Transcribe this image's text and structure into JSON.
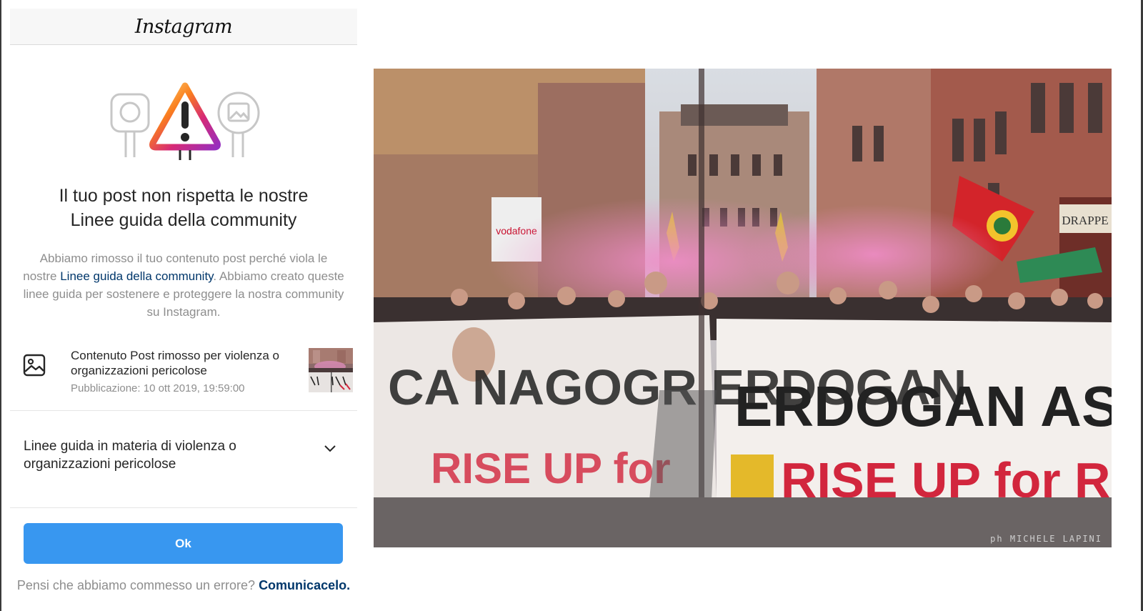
{
  "app": {
    "brand": "Instagram"
  },
  "notice": {
    "headline_line1": "Il tuo post non rispetta le nostre",
    "headline_line2": "Linee guida della community",
    "desc_part1": "Abbiamo rimosso il tuo contenuto post perché viola le nostre ",
    "desc_link": "Linee guida della community",
    "desc_part2": ". Abbiamo creato queste linee guida per sostenere e proteggere la nostra community su Instagram."
  },
  "removed_item": {
    "icon": "image-icon",
    "title": "Contenuto Post rimosso per violenza o organizzazioni pericolose",
    "date": "Pubblicazione: 10 ott 2019, 19:59:00"
  },
  "guideline": {
    "label": "Linee guida in materia di violenza o organizzazioni pericolose",
    "icon": "chevron-down-icon"
  },
  "actions": {
    "ok_label": "Ok",
    "footer_text": "Pensi che abbiamo commesso un errore? ",
    "footer_link": "Comunicacelo."
  },
  "photo": {
    "banner_left": "CA NAGOGR ERDOGAN",
    "banner_left_sub": "RISE UP for",
    "banner_right": "ERDOGAN ASS",
    "banner_right_sub": "RISE UP for R",
    "storefront": "vodafone",
    "shop_sign": "DRAPPE",
    "credit": "ph MICHELE LAPINI"
  },
  "colors": {
    "primary_button": "#3897f0",
    "link": "#00376b",
    "muted_text": "#8e8e8e"
  }
}
